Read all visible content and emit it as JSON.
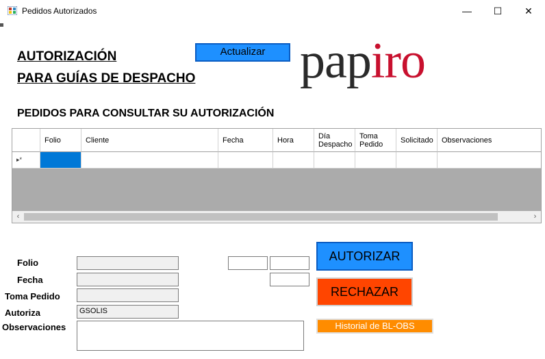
{
  "window": {
    "title": "Pedidos Autorizados",
    "minimize": "—",
    "maximize": "☐",
    "close": "✕"
  },
  "header": {
    "line1": "AUTORIZACIÓN",
    "line2": "PARA GUÍAS DE DESPACHO",
    "refresh_label": "Actualizar",
    "logo_part1": "pap",
    "logo_part2": "iro"
  },
  "section_title": "PEDIDOS PARA CONSULTAR SU AUTORIZACIÓN",
  "grid": {
    "columns": [
      "Folio",
      "Cliente",
      "Fecha",
      "Hora",
      "Día Despacho",
      "Toma Pedido",
      "Solicitado",
      "Observaciones"
    ],
    "new_row_marker": "▸*",
    "scroll_left": "‹",
    "scroll_right": "›"
  },
  "form": {
    "folio_label": "Folio",
    "fecha_label": "Fecha",
    "toma_pedido_label": "Toma Pedido",
    "autoriza_label": "Autoriza",
    "observaciones_label": "Observaciones",
    "folio_value": "",
    "fecha_value": "",
    "toma_pedido_value": "",
    "autoriza_value": "GSOLIS"
  },
  "actions": {
    "autorizar": "AUTORIZAR",
    "rechazar": "RECHAZAR",
    "historial": "Historial de BL-OBS"
  },
  "colors": {
    "blue": "#1e90ff",
    "red": "#ff4500",
    "orange": "#ff8c00",
    "logo_red": "#c8102e"
  }
}
